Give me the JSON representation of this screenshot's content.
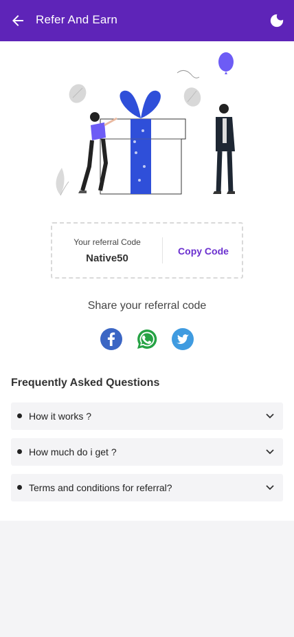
{
  "appbar": {
    "title": "Refer And Earn",
    "back_icon": "arrow-left-icon",
    "theme_icon": "moon-icon",
    "background": "#5e24b8"
  },
  "referral": {
    "label": "Your referral Code",
    "code": "Native50",
    "copy_label": "Copy Code"
  },
  "share": {
    "title": "Share your referral code",
    "networks": [
      {
        "name": "facebook",
        "icon": "facebook-icon",
        "color": "#3b66c4"
      },
      {
        "name": "whatsapp",
        "icon": "whatsapp-icon",
        "color": "#25a244"
      },
      {
        "name": "twitter",
        "icon": "twitter-icon",
        "color": "#3f9be0"
      }
    ]
  },
  "faq": {
    "title": "Frequently Asked Questions",
    "items": [
      {
        "label": "How it works ?"
      },
      {
        "label": "How much do i get ?"
      },
      {
        "label": "Terms and conditions for referral?"
      }
    ]
  },
  "colors": {
    "accent": "#6a2fcf",
    "gift_ribbon": "#2f4fd9"
  }
}
